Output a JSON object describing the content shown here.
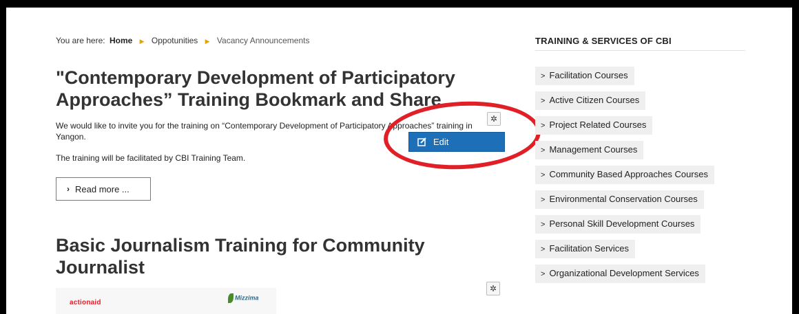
{
  "breadcrumb": {
    "prefix": "You are here:",
    "home": "Home",
    "opportunities": "Oppotunities",
    "current": "Vacancy Announcements"
  },
  "article1": {
    "title": "\"Contemporary Development of Participatory Approaches” Training Bookmark and Share",
    "intro": "We would like to invite you for the training on “Contemporary Development of Participatory Approaches” training in Yangon.",
    "facilitator": "The training will be facilitated by CBI Training Team.",
    "read_more": "Read more ...",
    "edit_label": "Edit"
  },
  "article2": {
    "title": "Basic Journalism Training for Community Journalist",
    "logo_left": "actionaid",
    "logo_right": "Mizzima"
  },
  "sidebar": {
    "title": "TRAINING & SERVICES OF CBI",
    "items": [
      {
        "label": "Facilitation Courses"
      },
      {
        "label": "Active Citizen Courses"
      },
      {
        "label": "Project Related Courses"
      },
      {
        "label": "Management Courses"
      },
      {
        "label": "Community Based Approaches Courses"
      },
      {
        "label": "Environmental Conservation Courses"
      },
      {
        "label": "Personal Skill Development Courses"
      },
      {
        "label": "Facilitation Services"
      },
      {
        "label": "Organizational Development Services"
      }
    ]
  },
  "icons": {
    "gear": "gear-icon",
    "edit": "edit-icon",
    "chevron": "chevron-right-icon"
  },
  "colors": {
    "dropdown_bg": "#1d6fb8",
    "highlight_ellipse": "#e01f26",
    "breadcrumb_separator": "#e6a200"
  }
}
